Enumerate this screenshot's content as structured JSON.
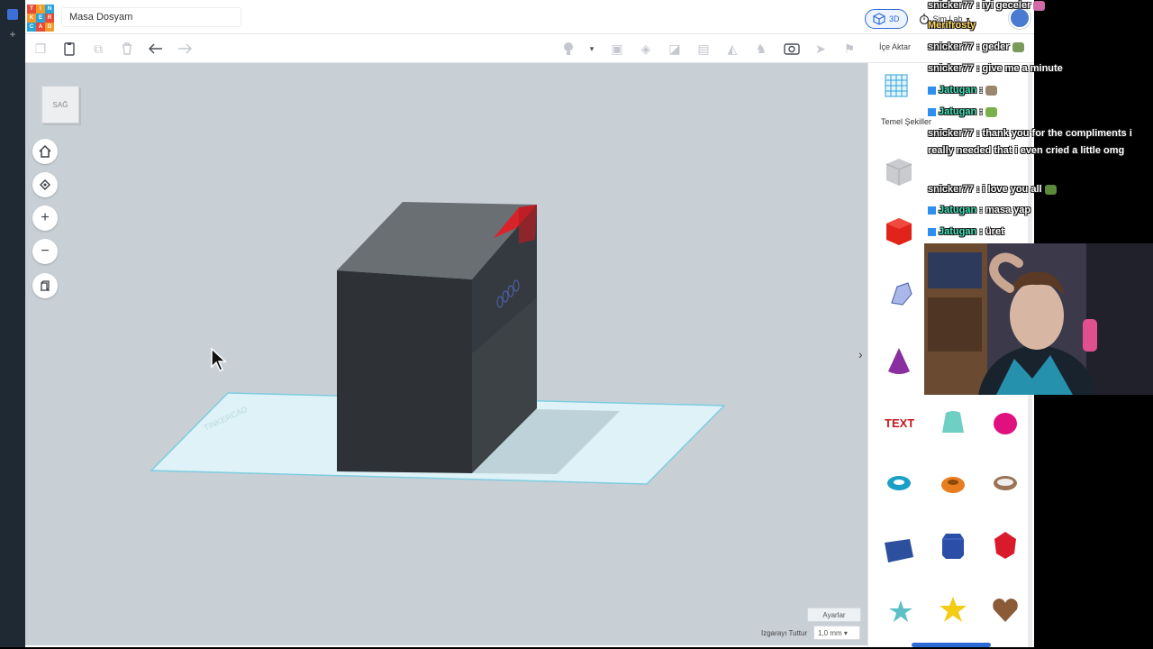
{
  "app": {
    "logo_letters": [
      "T",
      "I",
      "N",
      "K",
      "E",
      "R",
      "C",
      "A",
      "D"
    ],
    "logo_colors": [
      "#e54b37",
      "#f39a2b",
      "#2aa5d8",
      "#f39a2b",
      "#2aa5d8",
      "#e54b37",
      "#2aa5d8",
      "#e54b37",
      "#f39a2b"
    ],
    "title": "Masa Dosyam",
    "mode_label": "3D",
    "sim_label": "Sim Lab"
  },
  "toolbar": {
    "import_label": "İçe Aktar"
  },
  "viewport": {
    "view_cube_label": "SAĞ",
    "settings_label": "Ayarlar",
    "grid_snap_label": "Izgarayı Tuttur",
    "grid_snap_value": "1,0 mm",
    "collapse_glyph": "›"
  },
  "panel": {
    "category_label": "Temel Şekiller"
  },
  "chat": {
    "messages": [
      {
        "user": "snicker77",
        "text": " : iyi geceler",
        "style": "normal",
        "badge": false
      },
      {
        "user": "Merifrosty",
        "text": "",
        "style": "gold",
        "badge": false
      },
      {
        "user": "snicker77",
        "text": " : geder",
        "style": "normal",
        "badge": false
      },
      {
        "user": "snicker77",
        "text": " : give me a minute",
        "style": "normal",
        "badge": false
      },
      {
        "user": "Jatugan",
        "text": " :",
        "style": "teal",
        "badge": true
      },
      {
        "user": "Jatugan",
        "text": " :",
        "style": "teal",
        "badge": true
      },
      {
        "user": "snicker77",
        "text": " : thank you for the compliments i",
        "style": "normal",
        "badge": false
      },
      {
        "user": "",
        "text": "really needed that i even cried a little omg",
        "style": "normal",
        "badge": false
      },
      {
        "user": "snicker77",
        "text": " : i love you all",
        "style": "normal",
        "badge": false
      },
      {
        "user": "Jatugan",
        "text": " : masa yap",
        "style": "teal",
        "badge": true
      },
      {
        "user": "Jatugan",
        "text": " : üret",
        "style": "teal",
        "badge": true
      }
    ]
  },
  "colors": {
    "brand_blue": "#2c6bd6",
    "viewport_bg": "#c8d0d6",
    "workplane": "#def2f7",
    "box_dark": "#2e3236",
    "box_red": "#d8232a"
  }
}
